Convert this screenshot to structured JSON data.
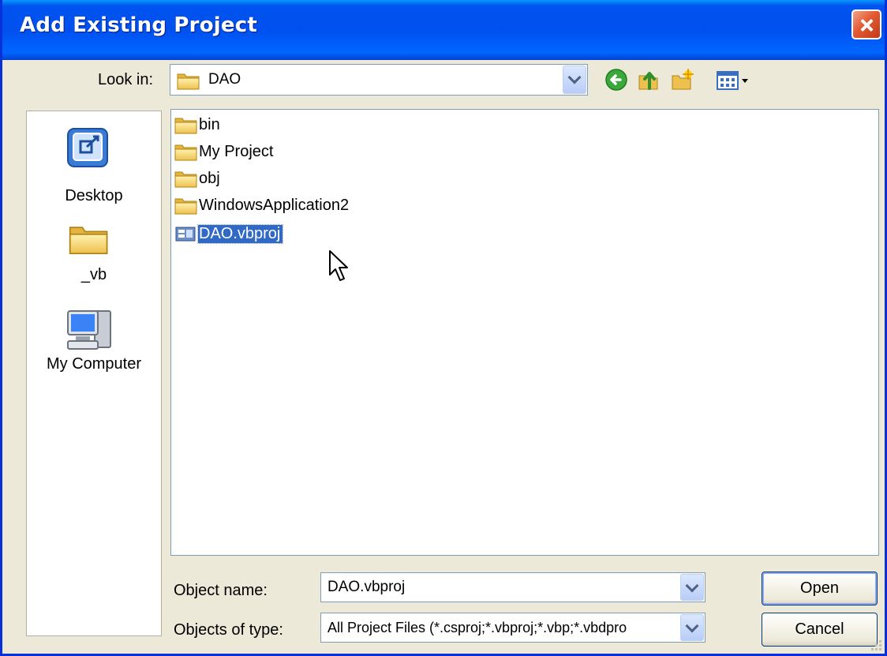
{
  "window": {
    "title": "Add Existing Project",
    "close_icon": "close-icon"
  },
  "look_in": {
    "label": "Look in:",
    "value": "DAO"
  },
  "toolbar": {
    "back_icon": "back-icon",
    "up_icon": "up-folder-icon",
    "new_folder_icon": "new-folder-icon",
    "views_icon": "views-menu-icon"
  },
  "places": [
    {
      "label": "Desktop",
      "icon": "desktop-icon"
    },
    {
      "label": "_vb",
      "icon": "folder-icon"
    },
    {
      "label": "My Computer",
      "icon": "my-computer-icon"
    }
  ],
  "files": [
    {
      "name": "bin",
      "type": "folder"
    },
    {
      "name": "My Project",
      "type": "folder"
    },
    {
      "name": "obj",
      "type": "folder"
    },
    {
      "name": "WindowsApplication2",
      "type": "folder"
    },
    {
      "name": "DAO.vbproj",
      "type": "vbproj",
      "selected": true
    }
  ],
  "object_name": {
    "label": "Object name:",
    "value": "DAO.vbproj"
  },
  "object_type": {
    "label": "Objects of type:",
    "value": "All Project Files (*.csproj;*.vbproj;*.vbp;*.vbdpro"
  },
  "buttons": {
    "open": "Open",
    "cancel": "Cancel"
  },
  "colors": {
    "title_bar": "#0054e3",
    "selection": "#316ac5",
    "dialog_bg": "#ece9d8"
  }
}
